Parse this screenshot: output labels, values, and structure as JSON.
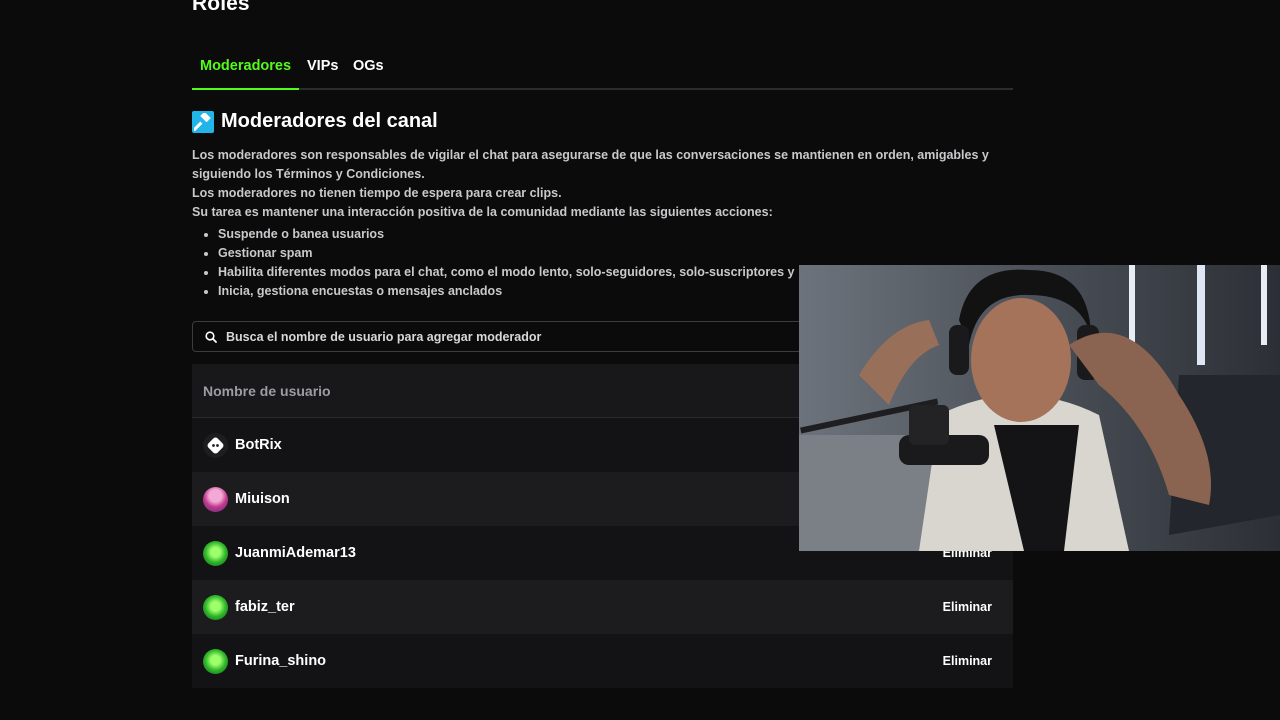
{
  "page": {
    "title": "Roles"
  },
  "tabs": [
    {
      "label": "Moderadores",
      "active": true
    },
    {
      "label": "VIPs",
      "active": false
    },
    {
      "label": "OGs",
      "active": false
    }
  ],
  "section": {
    "icon": "hammer-icon",
    "title": "Moderadores del canal",
    "description_lines": [
      "Los moderadores son responsables de vigilar el chat para asegurarse de que las conversaciones se mantienen en orden, amigables y siguiendo los Términos y Condiciones.",
      "Los moderadores no tienen tiempo de espera para crear clips.",
      "Su tarea es mantener una interacción positiva de la comunidad mediante las siguientes acciones:"
    ],
    "actions": [
      "Suspende o banea usuarios",
      "Gestionar spam",
      "Habilita diferentes modos para el chat, como el modo lento, solo-seguidores, solo-suscriptores y",
      "Inicia, gestiona encuestas o mensajes anclados"
    ]
  },
  "search": {
    "placeholder": "Busca el nombre de usuario para agregar moderador",
    "value": ""
  },
  "table": {
    "header": "Nombre de usuario",
    "remove_label": "Eliminar",
    "rows": [
      {
        "username": "BotRix",
        "avatar": "bot-avatar"
      },
      {
        "username": "Miuison",
        "avatar": "pink-avatar"
      },
      {
        "username": "JuanmiAdemar13",
        "avatar": "green-avatar"
      },
      {
        "username": "fabiz_ter",
        "avatar": "green-avatar"
      },
      {
        "username": "Furina_shino",
        "avatar": "green-avatar"
      }
    ]
  },
  "colors": {
    "accent": "#53fc18",
    "background": "#0b0b0c",
    "row_dark": "#131315",
    "row_light": "#1c1c1f",
    "icon_blue": "#22b6e8"
  }
}
